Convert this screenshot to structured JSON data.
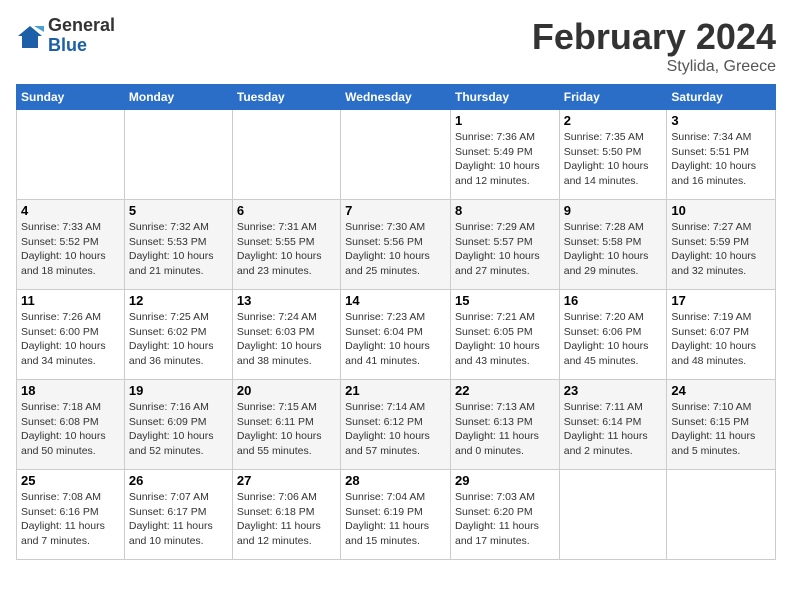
{
  "header": {
    "logo_general": "General",
    "logo_blue": "Blue",
    "month_title": "February 2024",
    "subtitle": "Stylida, Greece"
  },
  "calendar": {
    "days_of_week": [
      "Sunday",
      "Monday",
      "Tuesday",
      "Wednesday",
      "Thursday",
      "Friday",
      "Saturday"
    ],
    "weeks": [
      [
        {
          "num": "",
          "info": ""
        },
        {
          "num": "",
          "info": ""
        },
        {
          "num": "",
          "info": ""
        },
        {
          "num": "",
          "info": ""
        },
        {
          "num": "1",
          "info": "Sunrise: 7:36 AM\nSunset: 5:49 PM\nDaylight: 10 hours\nand 12 minutes."
        },
        {
          "num": "2",
          "info": "Sunrise: 7:35 AM\nSunset: 5:50 PM\nDaylight: 10 hours\nand 14 minutes."
        },
        {
          "num": "3",
          "info": "Sunrise: 7:34 AM\nSunset: 5:51 PM\nDaylight: 10 hours\nand 16 minutes."
        }
      ],
      [
        {
          "num": "4",
          "info": "Sunrise: 7:33 AM\nSunset: 5:52 PM\nDaylight: 10 hours\nand 18 minutes."
        },
        {
          "num": "5",
          "info": "Sunrise: 7:32 AM\nSunset: 5:53 PM\nDaylight: 10 hours\nand 21 minutes."
        },
        {
          "num": "6",
          "info": "Sunrise: 7:31 AM\nSunset: 5:55 PM\nDaylight: 10 hours\nand 23 minutes."
        },
        {
          "num": "7",
          "info": "Sunrise: 7:30 AM\nSunset: 5:56 PM\nDaylight: 10 hours\nand 25 minutes."
        },
        {
          "num": "8",
          "info": "Sunrise: 7:29 AM\nSunset: 5:57 PM\nDaylight: 10 hours\nand 27 minutes."
        },
        {
          "num": "9",
          "info": "Sunrise: 7:28 AM\nSunset: 5:58 PM\nDaylight: 10 hours\nand 29 minutes."
        },
        {
          "num": "10",
          "info": "Sunrise: 7:27 AM\nSunset: 5:59 PM\nDaylight: 10 hours\nand 32 minutes."
        }
      ],
      [
        {
          "num": "11",
          "info": "Sunrise: 7:26 AM\nSunset: 6:00 PM\nDaylight: 10 hours\nand 34 minutes."
        },
        {
          "num": "12",
          "info": "Sunrise: 7:25 AM\nSunset: 6:02 PM\nDaylight: 10 hours\nand 36 minutes."
        },
        {
          "num": "13",
          "info": "Sunrise: 7:24 AM\nSunset: 6:03 PM\nDaylight: 10 hours\nand 38 minutes."
        },
        {
          "num": "14",
          "info": "Sunrise: 7:23 AM\nSunset: 6:04 PM\nDaylight: 10 hours\nand 41 minutes."
        },
        {
          "num": "15",
          "info": "Sunrise: 7:21 AM\nSunset: 6:05 PM\nDaylight: 10 hours\nand 43 minutes."
        },
        {
          "num": "16",
          "info": "Sunrise: 7:20 AM\nSunset: 6:06 PM\nDaylight: 10 hours\nand 45 minutes."
        },
        {
          "num": "17",
          "info": "Sunrise: 7:19 AM\nSunset: 6:07 PM\nDaylight: 10 hours\nand 48 minutes."
        }
      ],
      [
        {
          "num": "18",
          "info": "Sunrise: 7:18 AM\nSunset: 6:08 PM\nDaylight: 10 hours\nand 50 minutes."
        },
        {
          "num": "19",
          "info": "Sunrise: 7:16 AM\nSunset: 6:09 PM\nDaylight: 10 hours\nand 52 minutes."
        },
        {
          "num": "20",
          "info": "Sunrise: 7:15 AM\nSunset: 6:11 PM\nDaylight: 10 hours\nand 55 minutes."
        },
        {
          "num": "21",
          "info": "Sunrise: 7:14 AM\nSunset: 6:12 PM\nDaylight: 10 hours\nand 57 minutes."
        },
        {
          "num": "22",
          "info": "Sunrise: 7:13 AM\nSunset: 6:13 PM\nDaylight: 11 hours\nand 0 minutes."
        },
        {
          "num": "23",
          "info": "Sunrise: 7:11 AM\nSunset: 6:14 PM\nDaylight: 11 hours\nand 2 minutes."
        },
        {
          "num": "24",
          "info": "Sunrise: 7:10 AM\nSunset: 6:15 PM\nDaylight: 11 hours\nand 5 minutes."
        }
      ],
      [
        {
          "num": "25",
          "info": "Sunrise: 7:08 AM\nSunset: 6:16 PM\nDaylight: 11 hours\nand 7 minutes."
        },
        {
          "num": "26",
          "info": "Sunrise: 7:07 AM\nSunset: 6:17 PM\nDaylight: 11 hours\nand 10 minutes."
        },
        {
          "num": "27",
          "info": "Sunrise: 7:06 AM\nSunset: 6:18 PM\nDaylight: 11 hours\nand 12 minutes."
        },
        {
          "num": "28",
          "info": "Sunrise: 7:04 AM\nSunset: 6:19 PM\nDaylight: 11 hours\nand 15 minutes."
        },
        {
          "num": "29",
          "info": "Sunrise: 7:03 AM\nSunset: 6:20 PM\nDaylight: 11 hours\nand 17 minutes."
        },
        {
          "num": "",
          "info": ""
        },
        {
          "num": "",
          "info": ""
        }
      ]
    ]
  }
}
